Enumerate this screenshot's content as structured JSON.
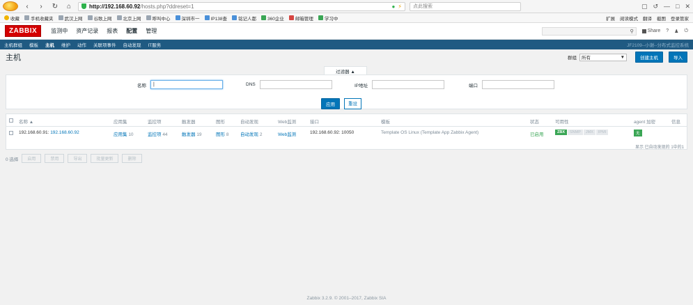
{
  "browser": {
    "url_host": "http://192.168.60.92",
    "url_path": "/hosts.php?ddreset=1",
    "search_placeholder": "点此搜索"
  },
  "bookmarks": {
    "items": [
      "收藏",
      "手机收藏夹",
      "武汉上网",
      "谷歌上网",
      "北京上网",
      "呼叫中心",
      "深圳市一",
      "IP138查",
      "铭记人都",
      "360企业",
      "邮箱管理",
      "学习中"
    ],
    "right": [
      "扩展",
      "阅读模式",
      "翻译",
      "截图",
      "登录管家"
    ]
  },
  "zabbix": {
    "logo": "ZABBIX",
    "menu": [
      "监测中",
      "资产记录",
      "报表",
      "配置",
      "管理"
    ],
    "active_menu": "配置",
    "share": "Share",
    "help": "?",
    "user": "♟",
    "logout": "⏻"
  },
  "subnav": {
    "items": [
      "主机群组",
      "模板",
      "主机",
      "维护",
      "动作",
      "关联项事件",
      "自动发现",
      "IT服务"
    ],
    "active": "主机",
    "server_name": "JF2109--小谢--分布式监控系统"
  },
  "page": {
    "title": "主机",
    "group_label": "群组",
    "group_value": "所有",
    "create_button": "创建主机",
    "import_button": "导入"
  },
  "filter": {
    "tab_label": "过滤器 ▲",
    "name_label": "名称",
    "name_value": "|",
    "dns_label": "DNS",
    "dns_value": "",
    "ip_label": "IP地址",
    "ip_value": "",
    "port_label": "端口",
    "port_value": "",
    "apply": "应用",
    "reset": "重设"
  },
  "table": {
    "headers": {
      "name": "名称 ▲",
      "applications": "应用集",
      "items": "监控项",
      "triggers": "触发器",
      "graphs": "图形",
      "discovery": "自动发现",
      "web": "Web监测",
      "interface": "接口",
      "templates": "模板",
      "status": "状态",
      "availability": "可用性",
      "agent_encryption": "agent 加密",
      "info": "信息"
    },
    "row": {
      "prefix": "192.168.60.91:",
      "name": "192.168.60.92",
      "applications": "应用集",
      "applications_count": "10",
      "items": "监控项",
      "items_count": "44",
      "triggers": "触发器",
      "triggers_count": "19",
      "graphs": "图形",
      "graphs_count": "8",
      "discovery": "自动发现",
      "discovery_count": "2",
      "web": "Web监测",
      "interface": "192.168.60.92: 10050",
      "templates": "Template OS Linux (Template App Zabbix Agent)",
      "status": "已启用",
      "avail": [
        "ZBX",
        "SNMP",
        "JMX",
        "IPMI"
      ],
      "encryption": "无"
    },
    "footer_info": "显示 已自动发现的 1中的1"
  },
  "actions": {
    "selected": "0 选择",
    "buttons": [
      "启用",
      "禁用",
      "导出",
      "批量更新",
      "删除"
    ]
  },
  "footer": "Zabbix 3.2.9. © 2001–2017, Zabbix SIA"
}
